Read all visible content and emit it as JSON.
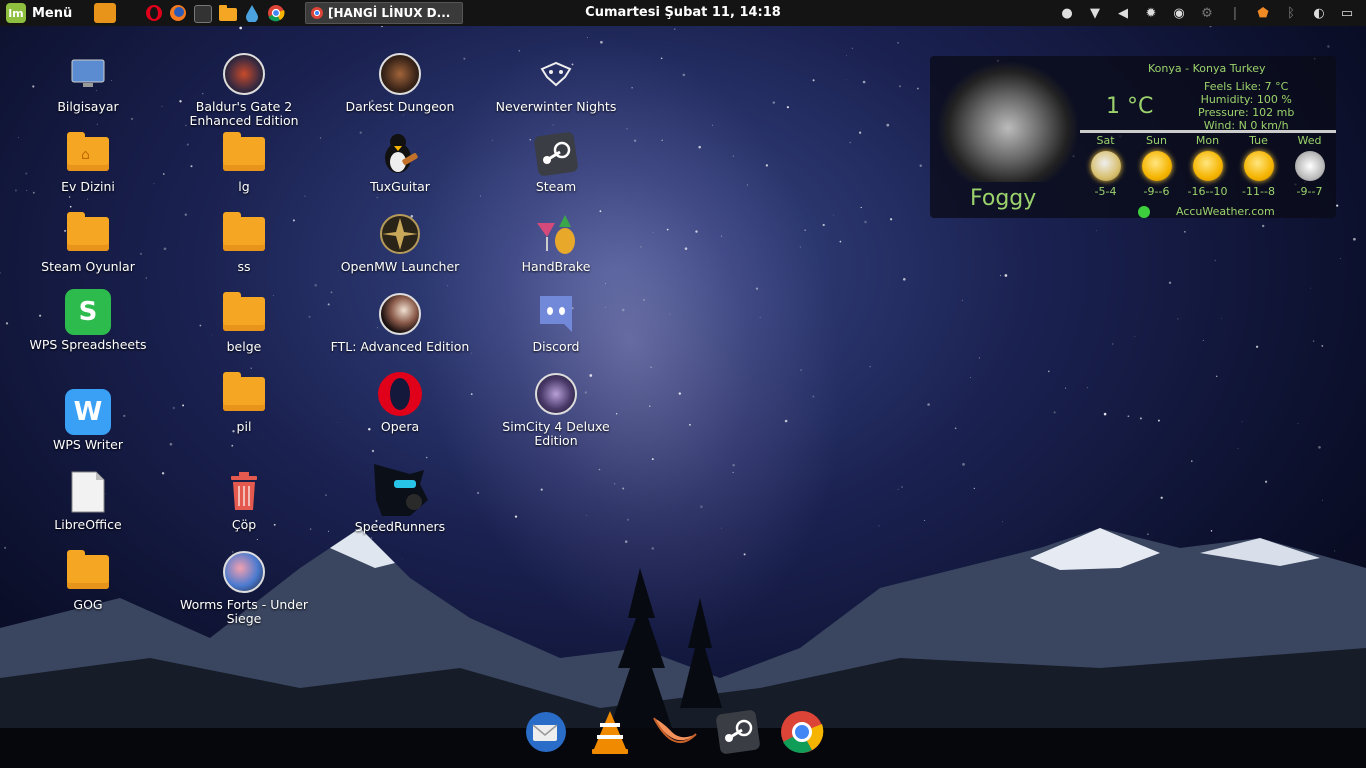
{
  "panel": {
    "menu_label": "Menü",
    "task_title": "[HANGİ LİNUX D...",
    "clock": "Cumartesi Şubat 11, 14:18",
    "launchers": [
      "opera-icon",
      "firefox-icon",
      "terminal-icon",
      "files-icon",
      "water-icon",
      "chrome-icon"
    ],
    "tray": [
      "user-icon",
      "wifi-icon",
      "volume-icon",
      "brightness-icon",
      "discord-icon",
      "steam-icon",
      "thermometer-icon",
      "security-icon",
      "bluetooth-icon",
      "network-icon",
      "window-icon"
    ]
  },
  "desktop": {
    "icons": [
      {
        "label": "Bilgisayar",
        "icon": "computer-icon"
      },
      {
        "label": "Ev Dizini",
        "icon": "home-folder-icon"
      },
      {
        "label": "Steam Oyunlar",
        "icon": "folder-icon"
      },
      {
        "label": "WPS Spreadsheets",
        "icon": "wps-spreadsheets-icon"
      },
      {
        "label": "WPS Writer",
        "icon": "wps-writer-icon"
      },
      {
        "label": "LibreOffice",
        "icon": "libreoffice-icon"
      },
      {
        "label": "GOG",
        "icon": "folder-icon"
      },
      {
        "label": "Baldur's Gate 2 Enhanced Edition",
        "icon": "baldurs-gate-icon"
      },
      {
        "label": "lg",
        "icon": "folder-icon"
      },
      {
        "label": "ss",
        "icon": "folder-icon"
      },
      {
        "label": "belge",
        "icon": "folder-icon"
      },
      {
        "label": "pil",
        "icon": "folder-icon"
      },
      {
        "label": "Çöp",
        "icon": "trash-icon"
      },
      {
        "label": "Worms Forts - Under Siege",
        "icon": "worms-icon"
      },
      {
        "label": "Darkest Dungeon",
        "icon": "darkest-dungeon-icon"
      },
      {
        "label": "TuxGuitar",
        "icon": "tuxguitar-icon"
      },
      {
        "label": "OpenMW Launcher",
        "icon": "openmw-icon"
      },
      {
        "label": "FTL: Advanced Edition",
        "icon": "ftl-icon"
      },
      {
        "label": "Opera",
        "icon": "opera-icon"
      },
      {
        "label": "SpeedRunners",
        "icon": "speedrunners-icon"
      },
      {
        "label": "Neverwinter Nights",
        "icon": "neverwinter-icon"
      },
      {
        "label": "Steam",
        "icon": "steam-icon"
      },
      {
        "label": "HandBrake",
        "icon": "handbrake-icon"
      },
      {
        "label": "Discord",
        "icon": "discord-icon"
      },
      {
        "label": "SimCity 4 Deluxe Edition",
        "icon": "simcity-icon"
      }
    ]
  },
  "weather": {
    "location": "Konya - Konya Turkey",
    "temperature": "1 °C",
    "feels_like": "Feels Like: 7 °C",
    "humidity": "Humidity: 100 %",
    "pressure": "Pressure: 102 mb",
    "wind": "Wind: N 0 km/h",
    "condition": "Foggy",
    "source": "AccuWeather.com",
    "forecast": [
      {
        "day": "Sat",
        "range": "-5-4"
      },
      {
        "day": "Sun",
        "range": "-9--6"
      },
      {
        "day": "Mon",
        "range": "-16--10"
      },
      {
        "day": "Tue",
        "range": "-11--8"
      },
      {
        "day": "Wed",
        "range": "-9--7"
      }
    ]
  },
  "dock": [
    "thunderbird-icon",
    "vlc-icon",
    "clementine-icon",
    "steam-icon",
    "chrome-icon"
  ]
}
